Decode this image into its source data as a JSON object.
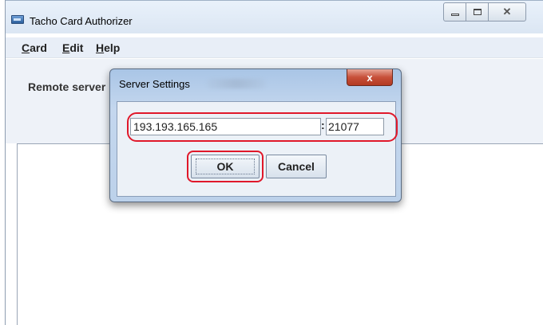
{
  "window": {
    "title": "Tacho Card Authorizer",
    "icon": "app-card-icon",
    "controls": {
      "minimize": "minimize-icon",
      "maximize": "maximize-icon",
      "close": "close-icon"
    }
  },
  "menu": {
    "items": [
      {
        "mnemonic": "C",
        "rest": "ard"
      },
      {
        "mnemonic": "E",
        "rest": "dit"
      },
      {
        "mnemonic": "H",
        "rest": "elp"
      }
    ]
  },
  "panel": {
    "remote_label": "Remote server"
  },
  "dialog": {
    "title": "Server Settings",
    "close_symbol": "x",
    "host_value": "193.193.165.165",
    "separator": ":",
    "port_value": "21077",
    "ok_label": "OK",
    "cancel_label": "Cancel"
  },
  "colors": {
    "highlight": "#e0182a",
    "title_close": "#c7503a",
    "menubar": "#e8eef7"
  }
}
